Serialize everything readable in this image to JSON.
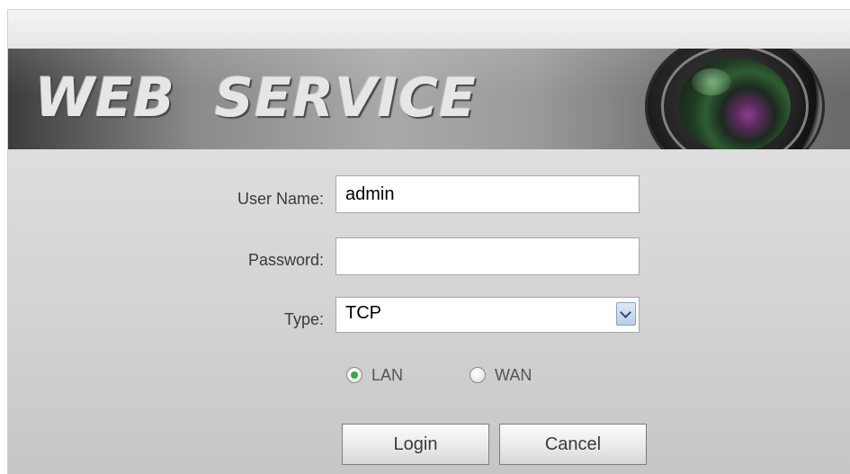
{
  "banner": {
    "title": "WEB  SERVICE"
  },
  "login_form": {
    "username_label": "User Name:",
    "username_value": "admin",
    "password_label": "Password:",
    "password_value": "",
    "type_label": "Type:",
    "type_value": "TCP",
    "network_options": [
      {
        "label": "LAN",
        "selected": true
      },
      {
        "label": "WAN",
        "selected": false
      }
    ],
    "login_button": "Login",
    "cancel_button": "Cancel"
  },
  "colors": {
    "radio_selected": "#3aa64a",
    "banner_text": "#e6e6e6"
  },
  "icons": {
    "banner_graphic": "camera-lens-icon",
    "type_dropdown": "chevron-down-icon"
  }
}
